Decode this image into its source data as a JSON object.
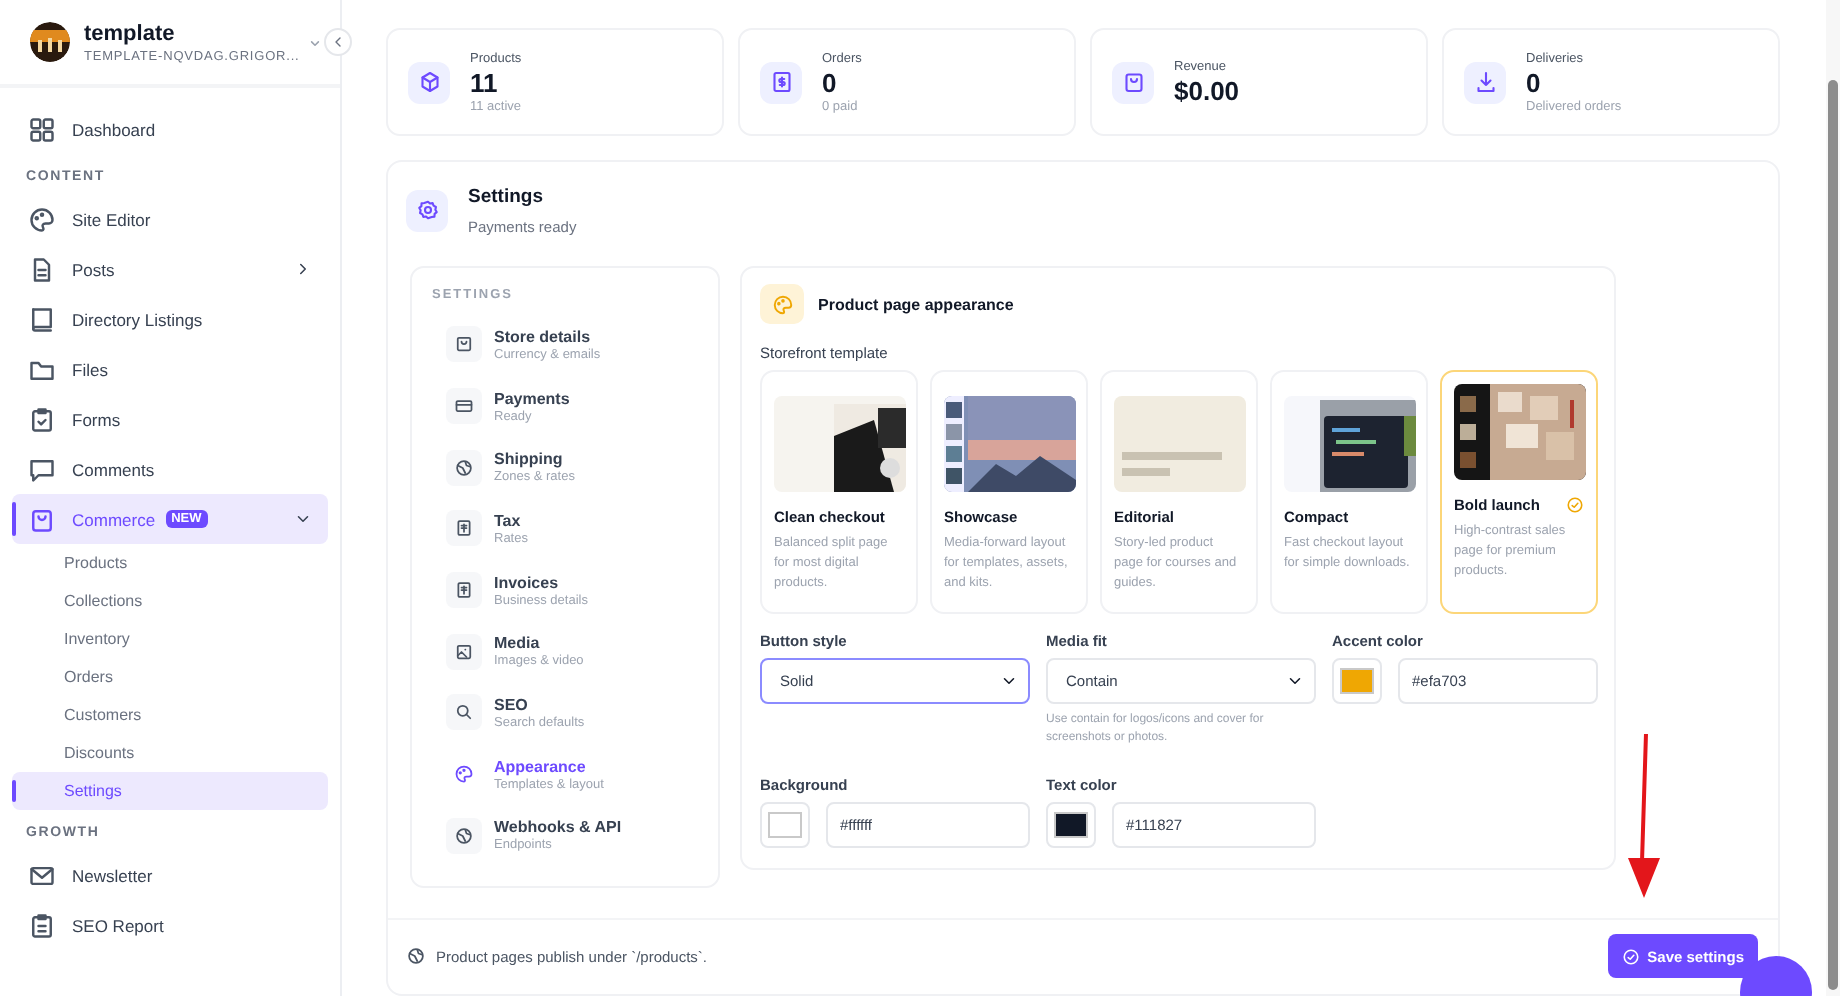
{
  "workspace": {
    "name": "template",
    "subtitle": "TEMPLATE-NQVDAG.GRIGOR..."
  },
  "sidebar": {
    "items": [
      {
        "kind": "link",
        "label": "Dashboard",
        "selected": false
      },
      {
        "kind": "heading",
        "label": "CONTENT"
      },
      {
        "kind": "link",
        "label": "Site Editor",
        "selected": false
      },
      {
        "kind": "link",
        "label": "Posts",
        "selected": false,
        "expanded": false
      },
      {
        "kind": "link",
        "label": "Directory Listings",
        "selected": false
      },
      {
        "kind": "link",
        "label": "Files",
        "selected": false
      },
      {
        "kind": "link",
        "label": "Forms",
        "selected": false
      },
      {
        "kind": "link",
        "label": "Comments",
        "selected": false
      },
      {
        "kind": "link",
        "label": "Commerce",
        "selected": true,
        "expanded": true,
        "badge": "NEW",
        "children": [
          {
            "label": "Products",
            "selected": false
          },
          {
            "label": "Collections",
            "selected": false
          },
          {
            "label": "Inventory",
            "selected": false
          },
          {
            "label": "Orders",
            "selected": false
          },
          {
            "label": "Customers",
            "selected": false
          },
          {
            "label": "Discounts",
            "selected": false
          },
          {
            "label": "Settings",
            "selected": true
          }
        ]
      },
      {
        "kind": "heading",
        "label": "GROWTH"
      },
      {
        "kind": "link",
        "label": "Newsletter",
        "selected": false
      },
      {
        "kind": "link",
        "label": "SEO Report",
        "selected": false
      }
    ]
  },
  "stats": [
    {
      "label": "Products",
      "value": "11",
      "note": "11 active"
    },
    {
      "label": "Orders",
      "value": "0",
      "note": "0 paid"
    },
    {
      "label": "Revenue",
      "value": "$0.00"
    },
    {
      "label": "Deliveries",
      "value": "0",
      "note": "Delivered orders"
    }
  ],
  "settings": {
    "title": "Settings",
    "subtitle": "Payments ready",
    "nav": {
      "heading": "SETTINGS",
      "items": [
        {
          "label": "Store details",
          "sub": "Currency & emails",
          "selected": false
        },
        {
          "label": "Payments",
          "sub": "Ready",
          "selected": false
        },
        {
          "label": "Shipping",
          "sub": "Zones & rates",
          "selected": false
        },
        {
          "label": "Tax",
          "sub": "Rates",
          "selected": false
        },
        {
          "label": "Invoices",
          "sub": "Business details",
          "selected": false
        },
        {
          "label": "Media",
          "sub": "Images & video",
          "selected": false
        },
        {
          "label": "SEO",
          "sub": "Search defaults",
          "selected": false
        },
        {
          "label": "Appearance",
          "sub": "Templates & layout",
          "selected": true
        },
        {
          "label": "Webhooks & API",
          "sub": "Endpoints",
          "selected": false
        }
      ]
    },
    "appearance": {
      "title": "Product page appearance",
      "template_label": "Storefront template",
      "templates": [
        {
          "name": "Clean checkout",
          "description": "Balanced split page for most digital products.",
          "selected": false
        },
        {
          "name": "Showcase",
          "description": "Media-forward layout for templates, assets, and kits.",
          "selected": false
        },
        {
          "name": "Editorial",
          "description": "Story-led product page for courses and guides.",
          "selected": false
        },
        {
          "name": "Compact",
          "description": "Fast checkout layout for simple downloads.",
          "selected": false
        },
        {
          "name": "Bold launch",
          "description": "High-contrast sales page for premium products.",
          "selected": true
        }
      ],
      "button_style": {
        "label": "Button style",
        "value": "Solid",
        "focused": true
      },
      "media_fit": {
        "label": "Media fit",
        "value": "Contain",
        "help": "Use contain for logos/icons and cover for screenshots or photos.",
        "focused": false
      },
      "accent_color": {
        "label": "Accent color",
        "value": "#efa703",
        "color": "#efa703"
      },
      "background": {
        "label": "Background",
        "value": "#ffffff",
        "color": "#ffffff"
      },
      "text_color": {
        "label": "Text color",
        "value": "#111827",
        "color": "#111827"
      }
    },
    "footer": {
      "note": "Product pages publish under `/products`.",
      "save_label": "Save settings"
    }
  }
}
